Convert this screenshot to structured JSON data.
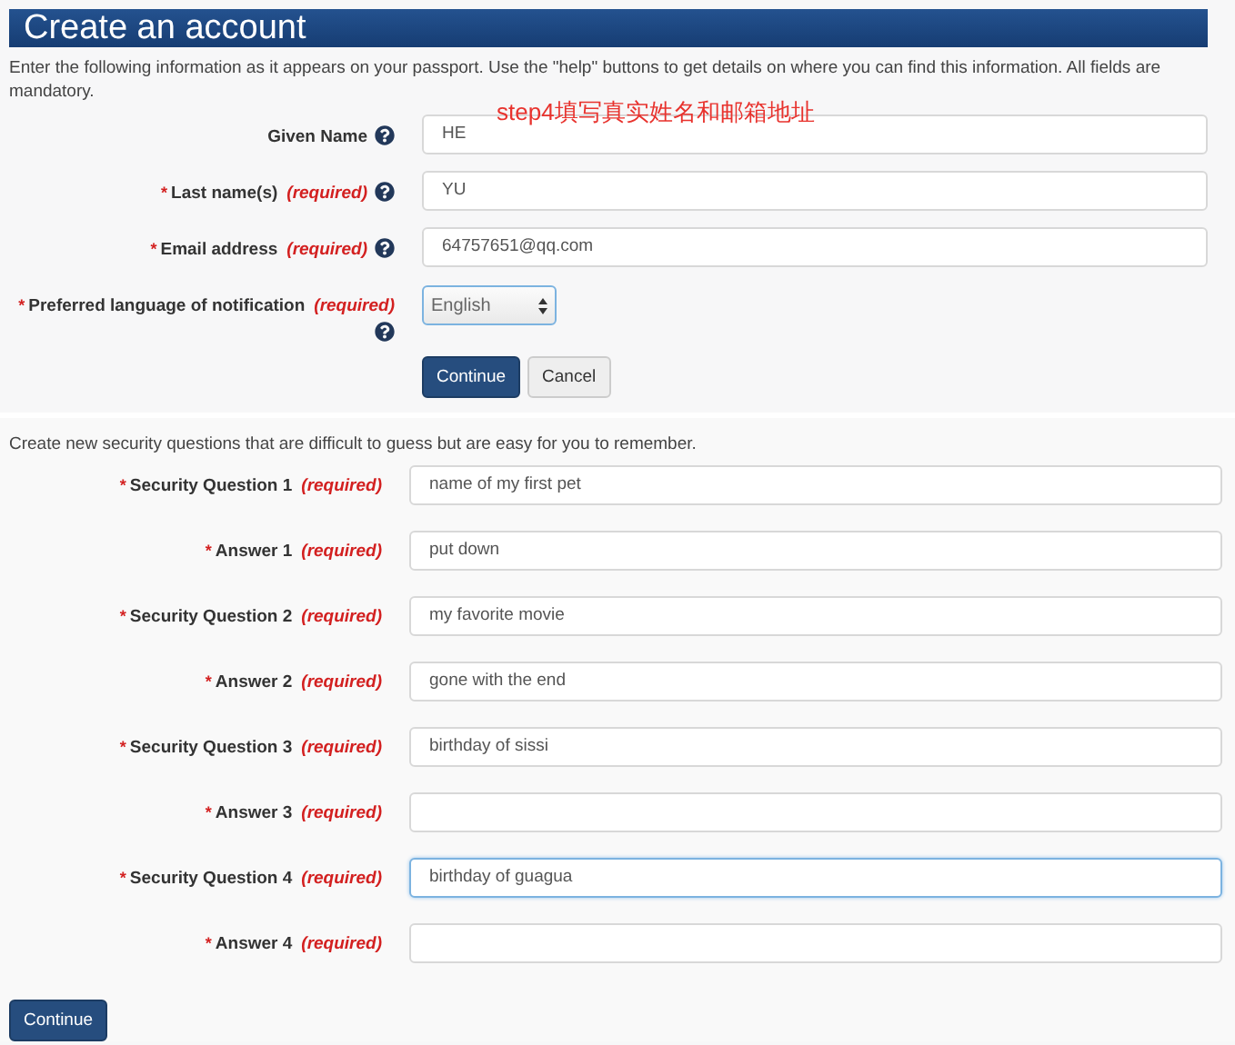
{
  "header": {
    "title": "Create an account"
  },
  "intro": "Enter the following information as it appears on your passport. Use the \"help\" buttons to get details on where you can find this information. All fields are mandatory.",
  "annotation": "step4填写真实姓名和邮箱地址",
  "account_fields": [
    {
      "label": "Given Name",
      "help": true,
      "kind": "text",
      "value": "HE",
      "focused": false
    },
    {
      "asterisk": "*",
      "label": "Last name(s)",
      "required_note": "(required)",
      "help": true,
      "kind": "text",
      "value": "YU",
      "focused": false
    },
    {
      "asterisk": "*",
      "label": "Email address",
      "required_note": "(required)",
      "help": true,
      "kind": "text",
      "value": "64757651@qq.com",
      "focused": false
    },
    {
      "asterisk": "*",
      "label": "Preferred language of notification",
      "required_note": "(required)",
      "help": true,
      "kind": "select",
      "value": "English",
      "focused": true
    }
  ],
  "account_buttons": [
    {
      "label": "Continue",
      "kind": "primary"
    },
    {
      "label": "Cancel",
      "kind": "default"
    }
  ],
  "security_intro": "Create new security questions that are difficult to guess but are easy for you to remember.",
  "security_fields": [
    {
      "asterisk": "*",
      "label": "Security Question 1",
      "required_note": "(required)",
      "value": "name of my first pet",
      "focused": false
    },
    {
      "asterisk": "*",
      "label": "Answer 1",
      "required_note": "(required)",
      "value": "put down",
      "focused": false
    },
    {
      "asterisk": "*",
      "label": "Security Question 2",
      "required_note": "(required)",
      "value": "my favorite movie",
      "focused": false
    },
    {
      "asterisk": "*",
      "label": "Answer 2",
      "required_note": "(required)",
      "value": "gone with the end",
      "focused": false
    },
    {
      "asterisk": "*",
      "label": "Security Question 3",
      "required_note": "(required)",
      "value": "birthday of sissi",
      "focused": false
    },
    {
      "asterisk": "*",
      "label": "Answer 3",
      "required_note": "(required)",
      "focused": false
    },
    {
      "asterisk": "*",
      "label": "Security Question 4",
      "required_note": "(required)",
      "value": "birthday of guagua",
      "focused": true
    },
    {
      "asterisk": "*",
      "label": "Answer 4",
      "required_note": "(required)",
      "focused": false
    }
  ],
  "security_button": {
    "label": "Continue",
    "kind": "primary"
  }
}
